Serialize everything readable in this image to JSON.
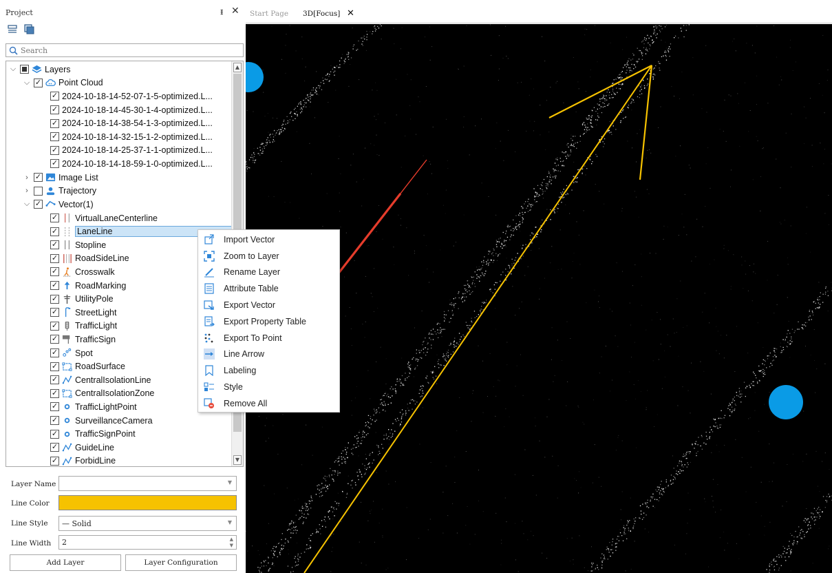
{
  "panel": {
    "title": "Project",
    "pin_glyph": "ᵻ",
    "close_glyph": "✕",
    "toolbar": [
      "layers-stack-icon",
      "window-icon"
    ]
  },
  "search": {
    "placeholder": "Search"
  },
  "tree": {
    "root": {
      "label": "Layers",
      "icon": "layers-icon"
    },
    "point_cloud": {
      "label": "Point Cloud",
      "icon": "cloud-icon",
      "items": [
        "2024-10-18-14-52-07-1-5-optimized.L...",
        "2024-10-18-14-45-30-1-4-optimized.L...",
        "2024-10-18-14-38-54-1-3-optimized.L...",
        "2024-10-18-14-32-15-1-2-optimized.L...",
        "2024-10-18-14-25-37-1-1-optimized.L...",
        "2024-10-18-14-18-59-1-0-optimized.L..."
      ]
    },
    "image_list": {
      "label": "Image List",
      "icon": "image-icon",
      "checked": true
    },
    "trajectory": {
      "label": "Trajectory",
      "icon": "person-icon",
      "checked": false
    },
    "vector": {
      "label": "Vector(1)",
      "icon": "vector-icon",
      "items": [
        {
          "label": "VirtualLaneCenterline",
          "icon": "double-line-icon"
        },
        {
          "label": "LaneLine",
          "icon": "dashed-line-icon",
          "selected": true
        },
        {
          "label": "Stopline",
          "icon": "stopline-icon"
        },
        {
          "label": "RoadSideLine",
          "icon": "roadside-icon"
        },
        {
          "label": "Crosswalk",
          "icon": "pedestrian-icon"
        },
        {
          "label": "RoadMarking",
          "icon": "road-marking-icon"
        },
        {
          "label": "UtilityPole",
          "icon": "pole-icon"
        },
        {
          "label": "StreetLight",
          "icon": "street-light-icon"
        },
        {
          "label": "TrafficLight",
          "icon": "traffic-light-icon"
        },
        {
          "label": "TrafficSign",
          "icon": "sign-icon"
        },
        {
          "label": "Spot",
          "icon": "spot-icon"
        },
        {
          "label": "RoadSurface",
          "icon": "surface-icon"
        },
        {
          "label": "CentralIsolationLine",
          "icon": "polyline-icon"
        },
        {
          "label": "CentralIsolationZone",
          "icon": "zone-icon"
        },
        {
          "label": "TrafficLightPoint",
          "icon": "point-icon"
        },
        {
          "label": "SurveillanceCamera",
          "icon": "point-icon"
        },
        {
          "label": "TrafficSignPoint",
          "icon": "point-icon"
        },
        {
          "label": "GuideLine",
          "icon": "polyline-icon"
        },
        {
          "label": "ForbidLine",
          "icon": "polyline-icon"
        }
      ]
    }
  },
  "properties": {
    "layer_name_label": "Layer Name",
    "layer_name_value": "",
    "line_color_label": "Line Color",
    "line_color_value": "#f6c200",
    "line_style_label": "Line Style",
    "line_style_value": "— Solid",
    "line_width_label": "Line Width",
    "line_width_value": "2",
    "add_layer_button": "Add Layer",
    "layer_config_button": "Layer Configuration"
  },
  "tabs": [
    {
      "label": "Start Page",
      "active": false
    },
    {
      "label": "3D[Focus]",
      "active": true,
      "close_glyph": "✕"
    }
  ],
  "viewport": {
    "background": "#000000",
    "vector_color": "#f6c200",
    "annotation_arrow_color": "#e53c2b",
    "marker_color": "#0a9be6"
  },
  "context_menu": {
    "items": [
      {
        "label": "Import Vector",
        "icon": "import-icon"
      },
      {
        "label": "Zoom to Layer",
        "icon": "zoom-extent-icon"
      },
      {
        "label": "Rename Layer",
        "icon": "pencil-icon"
      },
      {
        "label": "Attribute Table",
        "icon": "table-icon"
      },
      {
        "label": "Export Vector",
        "icon": "export-icon"
      },
      {
        "label": "Export Property Table",
        "icon": "export-table-icon"
      },
      {
        "label": "Export To Point",
        "icon": "points-icon"
      },
      {
        "label": "Line Arrow",
        "icon": "arrow-right-icon"
      },
      {
        "label": "Labeling",
        "icon": "bookmark-icon"
      },
      {
        "label": "Style",
        "icon": "style-icon"
      },
      {
        "label": "Remove All",
        "icon": "remove-all-icon"
      }
    ]
  }
}
